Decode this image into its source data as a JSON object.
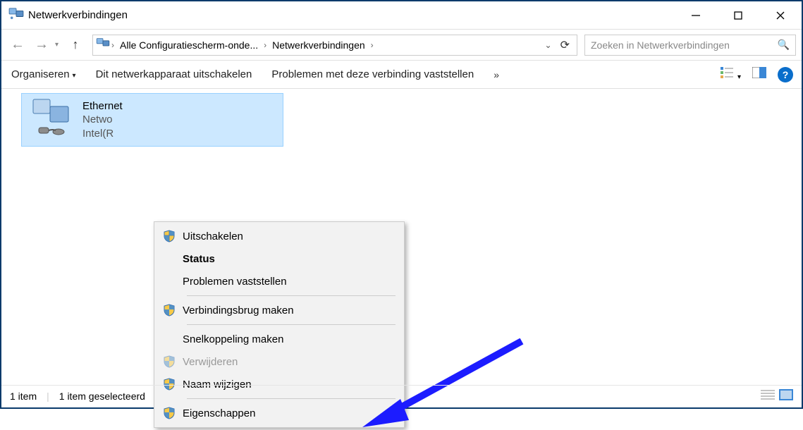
{
  "window": {
    "title": "Netwerkverbindingen"
  },
  "breadcrumb": {
    "seg1": "Alle Configuratiescherm-onde...",
    "seg2": "Netwerkverbindingen"
  },
  "search": {
    "placeholder": "Zoeken in Netwerkverbindingen"
  },
  "toolbar": {
    "organize": "Organiseren",
    "disable": "Dit netwerkapparaat uitschakelen",
    "diagnose": "Problemen met deze verbinding vaststellen",
    "more": "»"
  },
  "item": {
    "name": "Ethernet",
    "line2": "Netwo",
    "line3": "Intel(R"
  },
  "contextMenu": {
    "disable": "Uitschakelen",
    "status": "Status",
    "diagnose": "Problemen vaststellen",
    "bridge": "Verbindingsbrug maken",
    "shortcut": "Snelkoppeling maken",
    "delete": "Verwijderen",
    "rename": "Naam wijzigen",
    "properties": "Eigenschappen"
  },
  "statusbar": {
    "count": "1 item",
    "selected": "1 item geselecteerd"
  }
}
